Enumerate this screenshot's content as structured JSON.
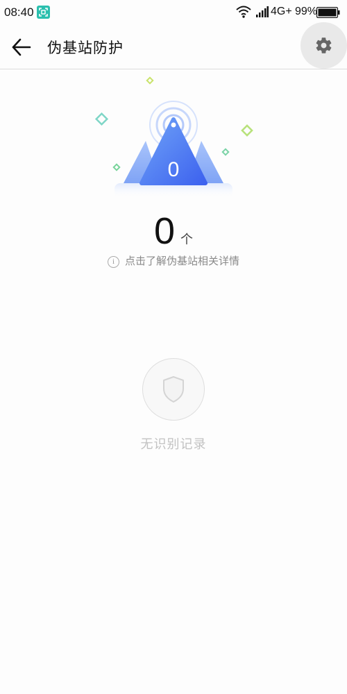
{
  "status_bar": {
    "time": "08:40",
    "network": "4G+",
    "battery": "99%"
  },
  "header": {
    "title": "伪基站防护"
  },
  "hero": {
    "badge_value": "0"
  },
  "summary": {
    "count": "0",
    "unit": "个",
    "info_text": "点击了解伪基站相关详情"
  },
  "empty_state": {
    "text": "无识别记录"
  },
  "icons": {
    "back": "arrow-left-icon",
    "settings": "gear-icon",
    "info": "info-icon",
    "shield": "shield-icon"
  },
  "colors": {
    "accent_blue": "#4f7cf5",
    "teal": "#2bbfae"
  }
}
